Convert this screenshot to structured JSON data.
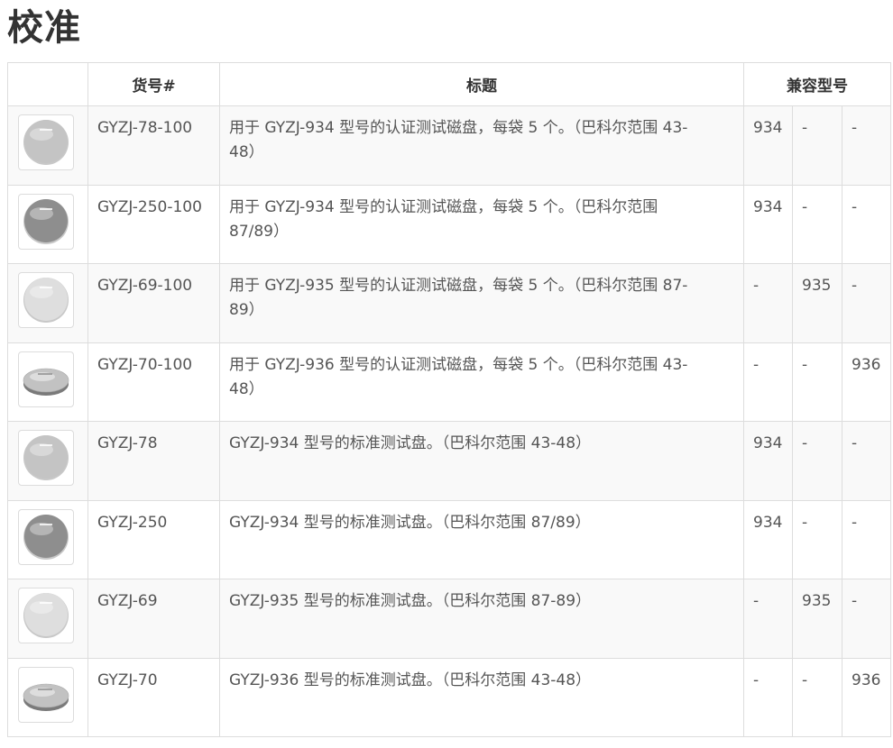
{
  "page": {
    "title": "校准"
  },
  "table": {
    "headers": {
      "image": "",
      "part_no": "货号#",
      "title": "标题",
      "compatible": "兼容型号"
    },
    "rows": [
      {
        "part_no": "GYZJ-78-100",
        "title": "用于 GYZJ-934 型号的认证测试磁盘，每袋 5 个。（巴科尔范围 43-48）",
        "compat": [
          "934",
          "-",
          "-"
        ],
        "thumb_icon": "disk-icon",
        "disk_color": "#c4c4c4",
        "disk_style": "flat"
      },
      {
        "part_no": "GYZJ-250-100",
        "title": "用于 GYZJ-934 型号的认证测试磁盘，每袋 5 个。（巴科尔范围 87/89）",
        "compat": [
          "934",
          "-",
          "-"
        ],
        "thumb_icon": "disk-icon",
        "disk_color": "#8e8e8e",
        "disk_style": "flat"
      },
      {
        "part_no": "GYZJ-69-100",
        "title": "用于 GYZJ-935 型号的认证测试磁盘，每袋 5 个。（巴科尔范围 87-89）",
        "compat": [
          "-",
          "935",
          "-"
        ],
        "thumb_icon": "disk-icon",
        "disk_color": "#dedede",
        "disk_style": "flat"
      },
      {
        "part_no": "GYZJ-70-100",
        "title": "用于 GYZJ-936 型号的认证测试磁盘，每袋 5 个。（巴科尔范围 43-48）",
        "compat": [
          "-",
          "-",
          "936"
        ],
        "thumb_icon": "disk-icon",
        "disk_color": "#c2c2c2",
        "disk_style": "tilted"
      },
      {
        "part_no": "GYZJ-78",
        "title": "GYZJ-934 型号的标准测试盘。（巴科尔范围 43-48）",
        "compat": [
          "934",
          "-",
          "-"
        ],
        "thumb_icon": "disk-icon",
        "disk_color": "#c4c4c4",
        "disk_style": "flat"
      },
      {
        "part_no": "GYZJ-250",
        "title": "GYZJ-934 型号的标准测试盘。（巴科尔范围 87/89）",
        "compat": [
          "934",
          "-",
          "-"
        ],
        "thumb_icon": "disk-icon",
        "disk_color": "#8e8e8e",
        "disk_style": "flat"
      },
      {
        "part_no": "GYZJ-69",
        "title": "GYZJ-935 型号的标准测试盘。（巴科尔范围 87-89）",
        "compat": [
          "-",
          "935",
          "-"
        ],
        "thumb_icon": "disk-icon",
        "disk_color": "#dedede",
        "disk_style": "flat"
      },
      {
        "part_no": "GYZJ-70",
        "title": "GYZJ-936 型号的标准测试盘。（巴科尔范围 43-48）",
        "compat": [
          "-",
          "-",
          "936"
        ],
        "thumb_icon": "disk-icon",
        "disk_color": "#c2c2c2",
        "disk_style": "tilted"
      }
    ]
  }
}
